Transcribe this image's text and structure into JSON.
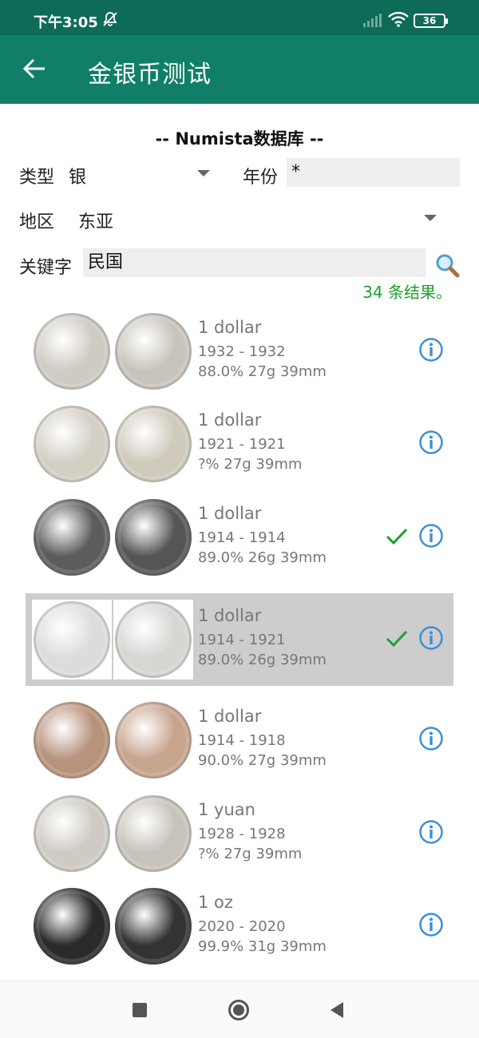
{
  "status": {
    "time": "下午3:05",
    "battery": "36"
  },
  "header": {
    "title": "金银币测试"
  },
  "filters": {
    "db_title": "-- Numista数据库 --",
    "type_label": "类型",
    "type_value": "银",
    "year_label": "年份",
    "year_value": "*",
    "region_label": "地区",
    "region_value": "东亚",
    "keyword_label": "关键字",
    "keyword_value": "民国"
  },
  "results": {
    "count_text": "34 条结果。"
  },
  "coins": [
    {
      "name": "1 dollar",
      "years": "1932 - 1932",
      "spec": "88.0% 27g 39mm",
      "owned": false,
      "selected": false,
      "obv": "#cfcac2",
      "rev": "#c9c4bb"
    },
    {
      "name": "1 dollar",
      "years": "1921 - 1921",
      "spec": "?% 27g 39mm",
      "owned": false,
      "selected": false,
      "obv": "#d4cfc3",
      "rev": "#cfcabc"
    },
    {
      "name": "1 dollar",
      "years": "1914 - 1914",
      "spec": "89.0% 26g 39mm",
      "owned": true,
      "selected": false,
      "obv": "#5c5d5b",
      "rev": "#555654"
    },
    {
      "name": "1 dollar",
      "years": "1914 - 1921",
      "spec": "89.0% 26g 39mm",
      "owned": true,
      "selected": true,
      "obv": "#dcdcda",
      "rev": "#d6d6d3"
    },
    {
      "name": "1 dollar",
      "years": "1914 - 1918",
      "spec": "90.0% 27g 39mm",
      "owned": false,
      "selected": false,
      "obv": "#b8937c",
      "rev": "#c7a48e"
    },
    {
      "name": "1 yuan",
      "years": "1928 - 1928",
      "spec": "?% 27g 39mm",
      "owned": false,
      "selected": false,
      "obv": "#cfcbc4",
      "rev": "#c8c3ba"
    },
    {
      "name": "1 oz",
      "years": "2020 - 2020",
      "spec": "99.9% 31g 39mm",
      "owned": false,
      "selected": false,
      "obv": "#2a2a2a",
      "rev": "#333333"
    }
  ],
  "colors": {
    "app_bar": "#117f68",
    "status_bar": "#0d6b57",
    "count_green": "#1aa329",
    "info_blue": "#3d8fd6",
    "check_green": "#1aa329",
    "selected_row": "#cdcdcd"
  }
}
